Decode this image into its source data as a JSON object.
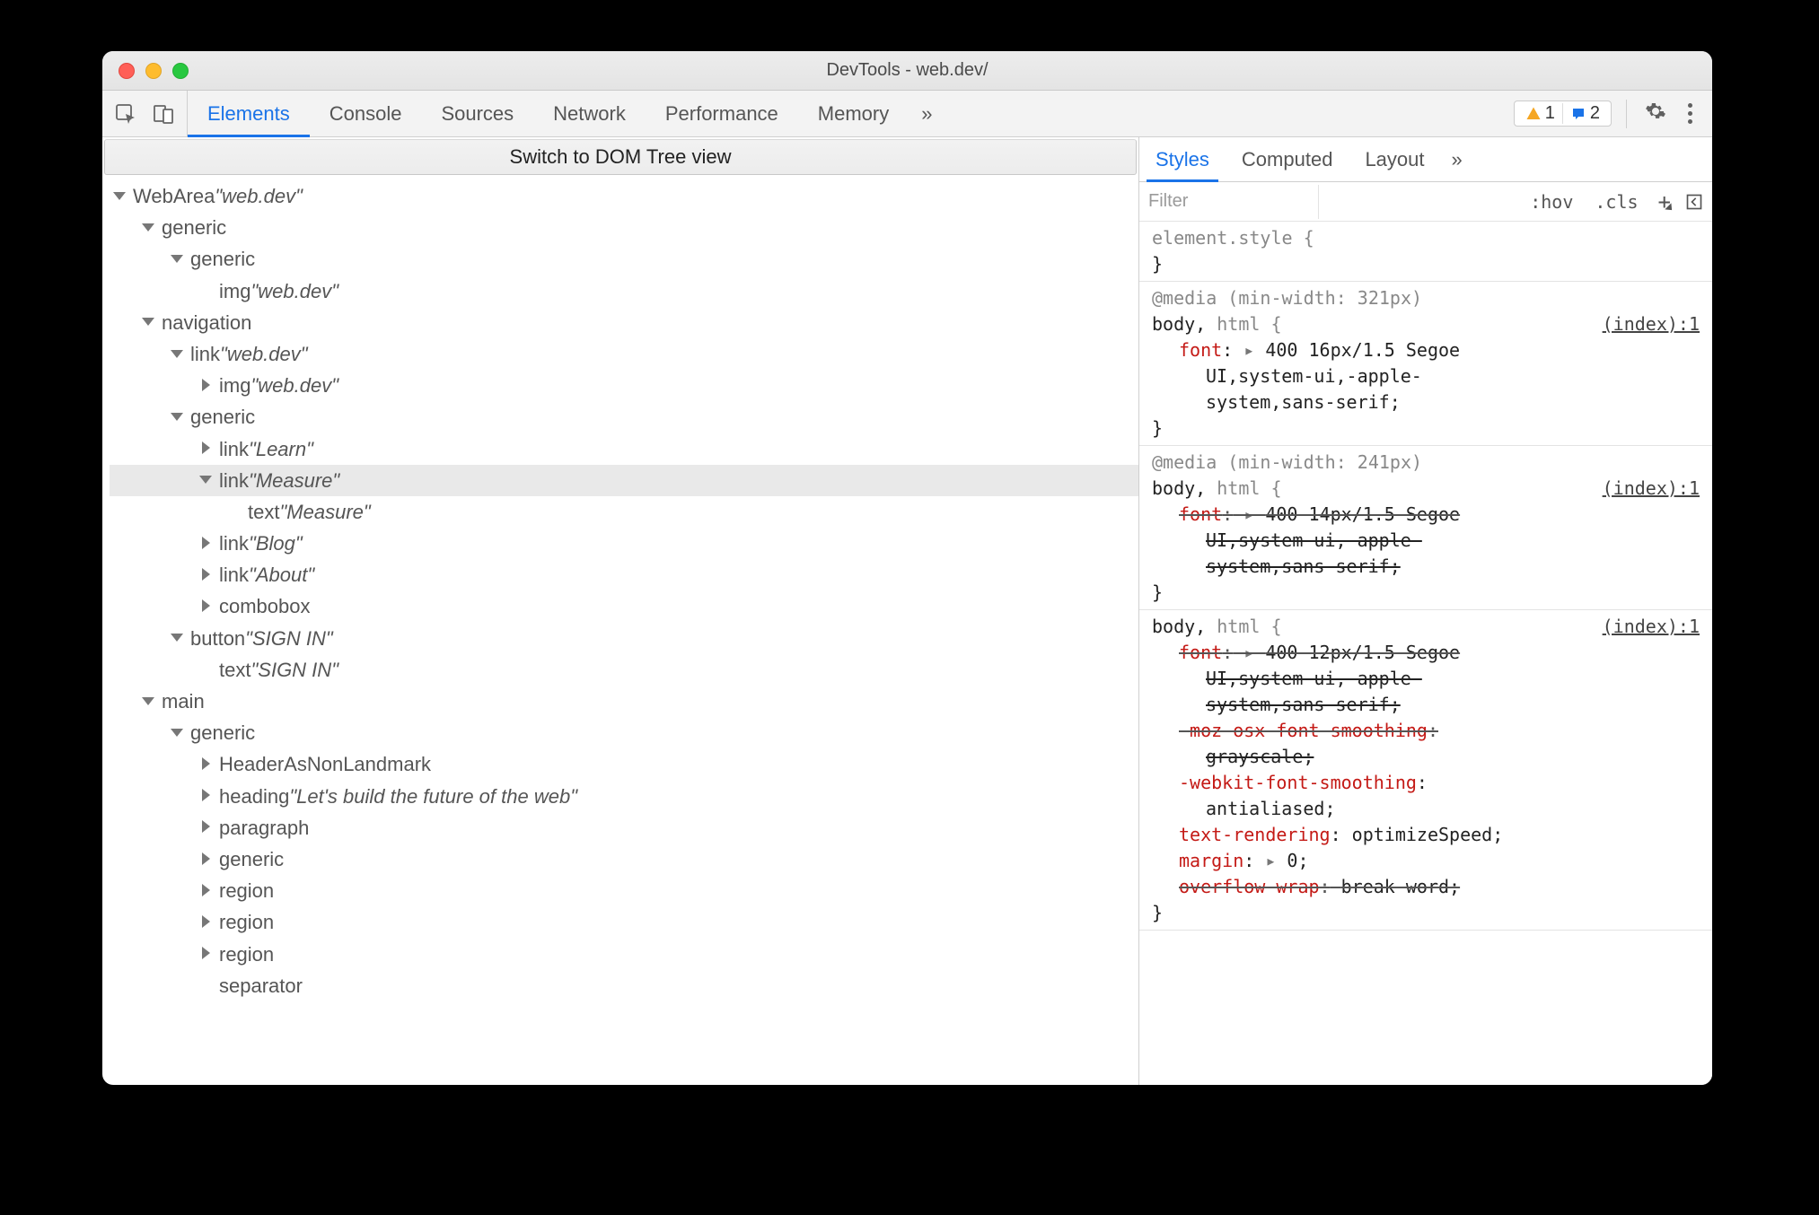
{
  "window": {
    "title": "DevTools - web.dev/"
  },
  "toolbar": {
    "tabs": [
      "Elements",
      "Console",
      "Sources",
      "Network",
      "Performance",
      "Memory"
    ],
    "active_index": 0,
    "more_glyph": "»",
    "warn_count": "1",
    "info_count": "2"
  },
  "switch_bar": "Switch to DOM Tree view",
  "tree": [
    {
      "indent": 0,
      "arrow": "down",
      "role": "WebArea",
      "name": "web.dev",
      "sel": false
    },
    {
      "indent": 1,
      "arrow": "down",
      "role": "generic",
      "name": null,
      "sel": false
    },
    {
      "indent": 2,
      "arrow": "down",
      "role": "generic",
      "name": null,
      "sel": false
    },
    {
      "indent": 3,
      "arrow": "none",
      "role": "img",
      "name": "web.dev",
      "sel": false
    },
    {
      "indent": 1,
      "arrow": "down",
      "role": "navigation",
      "name": null,
      "sel": false
    },
    {
      "indent": 2,
      "arrow": "down",
      "role": "link",
      "name": "web.dev",
      "sel": false
    },
    {
      "indent": 3,
      "arrow": "right",
      "role": "img",
      "name": "web.dev",
      "sel": false
    },
    {
      "indent": 2,
      "arrow": "down",
      "role": "generic",
      "name": null,
      "sel": false
    },
    {
      "indent": 3,
      "arrow": "right",
      "role": "link",
      "name": "Learn",
      "sel": false
    },
    {
      "indent": 3,
      "arrow": "down",
      "role": "link",
      "name": "Measure",
      "sel": true
    },
    {
      "indent": 4,
      "arrow": "none",
      "role": "text",
      "name": "Measure",
      "sel": false
    },
    {
      "indent": 3,
      "arrow": "right",
      "role": "link",
      "name": "Blog",
      "sel": false
    },
    {
      "indent": 3,
      "arrow": "right",
      "role": "link",
      "name": "About",
      "sel": false
    },
    {
      "indent": 3,
      "arrow": "right",
      "role": "combobox",
      "name": null,
      "sel": false
    },
    {
      "indent": 2,
      "arrow": "down",
      "role": "button",
      "name": "SIGN IN",
      "sel": false
    },
    {
      "indent": 3,
      "arrow": "none",
      "role": "text",
      "name": "SIGN IN",
      "sel": false
    },
    {
      "indent": 1,
      "arrow": "down",
      "role": "main",
      "name": null,
      "sel": false
    },
    {
      "indent": 2,
      "arrow": "down",
      "role": "generic",
      "name": null,
      "sel": false
    },
    {
      "indent": 3,
      "arrow": "right",
      "role": "HeaderAsNonLandmark",
      "name": null,
      "sel": false
    },
    {
      "indent": 3,
      "arrow": "right",
      "role": "heading",
      "name": "Let's build the future of the web",
      "sel": false
    },
    {
      "indent": 3,
      "arrow": "right",
      "role": "paragraph",
      "name": null,
      "sel": false
    },
    {
      "indent": 3,
      "arrow": "right",
      "role": "generic",
      "name": null,
      "sel": false
    },
    {
      "indent": 3,
      "arrow": "right",
      "role": "region",
      "name": null,
      "sel": false
    },
    {
      "indent": 3,
      "arrow": "right",
      "role": "region",
      "name": null,
      "sel": false
    },
    {
      "indent": 3,
      "arrow": "right",
      "role": "region",
      "name": null,
      "sel": false
    },
    {
      "indent": 3,
      "arrow": "none",
      "role": "separator",
      "name": null,
      "sel": false
    }
  ],
  "styles_panel": {
    "tabs": [
      "Styles",
      "Computed",
      "Layout"
    ],
    "active_index": 0,
    "more_glyph": "»",
    "filter_placeholder": "Filter",
    "hov": ":hov",
    "cls": ".cls",
    "plus": "+",
    "element_style": "element.style {",
    "close_brace": "}",
    "rules": [
      {
        "media": "@media (min-width: 321px)",
        "selector_dark": "body,",
        "selector_gray": " html {",
        "link": "(index):1",
        "props": [
          {
            "name": "font",
            "val": "400 16px/1.5 Segoe",
            "tri": true,
            "struck": false
          },
          {
            "cont": "UI,system-ui,-apple-",
            "struck": false
          },
          {
            "cont": "system,sans-serif;",
            "struck": false
          }
        ]
      },
      {
        "media": "@media (min-width: 241px)",
        "selector_dark": "body,",
        "selector_gray": " html {",
        "link": "(index):1",
        "props": [
          {
            "name": "font",
            "val": "400 14px/1.5 Segoe",
            "tri": true,
            "struck": true
          },
          {
            "cont": "UI,system-ui,-apple-",
            "struck": true
          },
          {
            "cont": "system,sans-serif;",
            "struck": true
          }
        ]
      },
      {
        "media": null,
        "selector_dark": "body,",
        "selector_gray": " html {",
        "link": "(index):1",
        "props": [
          {
            "name": "font",
            "val": "400 12px/1.5 Segoe",
            "tri": true,
            "struck": true
          },
          {
            "cont": "UI,system-ui,-apple-",
            "struck": true
          },
          {
            "cont": "system,sans-serif;",
            "struck": true
          },
          {
            "name": "-moz-osx-font-smoothing",
            "val": "",
            "tri": false,
            "struck": true
          },
          {
            "cont": "grayscale;",
            "struck": true
          },
          {
            "name": "-webkit-font-smoothing",
            "val": "",
            "tri": false,
            "struck": false
          },
          {
            "cont": "antialiased;",
            "struck": false
          },
          {
            "name": "text-rendering",
            "val": "optimizeSpeed;",
            "tri": false,
            "struck": false
          },
          {
            "name": "margin",
            "val": "0;",
            "tri": true,
            "struck": false
          },
          {
            "name": "overflow-wrap",
            "val": "break-word;",
            "tri": false,
            "struck": true
          }
        ]
      }
    ]
  }
}
